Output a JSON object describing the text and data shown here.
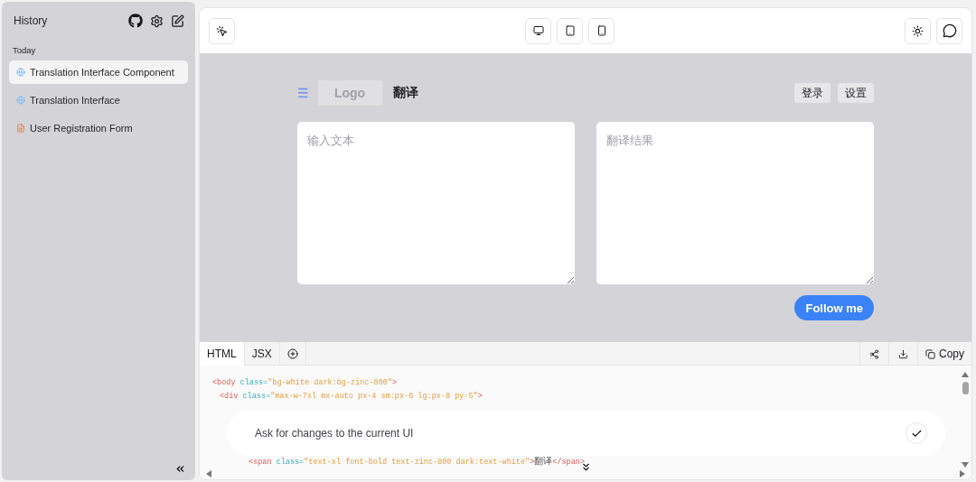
{
  "sidebar": {
    "title": "History",
    "section": "Today",
    "items": [
      {
        "label": "Translation Interface Component",
        "kind": "web",
        "selected": true
      },
      {
        "label": "Translation Interface",
        "kind": "web",
        "selected": false
      },
      {
        "label": "User Registration Form",
        "kind": "form",
        "selected": false
      }
    ]
  },
  "preview": {
    "menu_icon": "☰",
    "logo": "Logo",
    "title": "翻译",
    "buttons": [
      "登录",
      "设置"
    ],
    "fields": [
      {
        "placeholder": "输入文本"
      },
      {
        "placeholder": "翻译结果"
      }
    ],
    "follow": "Follow me"
  },
  "code": {
    "tabs": [
      {
        "label": "HTML",
        "selected": true
      },
      {
        "label": "JSX",
        "selected": false
      }
    ],
    "copy": "Copy",
    "lines": [
      {
        "parts": [
          {
            "kind": "tag",
            "text": "<body "
          },
          {
            "kind": "attr",
            "text": "class="
          },
          {
            "kind": "value",
            "text": "\"bg-white dark:bg-zinc-800\""
          },
          {
            "kind": "tag",
            "text": ">"
          }
        ],
        "children": [
          {
            "parts": [
              {
                "kind": "tag",
                "text": "<div "
              },
              {
                "kind": "attr",
                "text": "class="
              },
              {
                "kind": "value",
                "text": "\"max-w-7xl mx-auto px-4 sm:px-6 lg:px-8 py-5\""
              },
              {
                "kind": "tag",
                "text": ">"
              }
            ],
            "children": [
              {
                "parts": [
                  {
                    "kind": "tag",
                    "text": "<span "
                  },
                  {
                    "kind": "attr",
                    "text": "class="
                  },
                  {
                    "kind": "value",
                    "text": "\"text-xl font-bold text-zinc-800 dark:text-white\""
                  },
                  {
                    "kind": "tag",
                    "text": ">"
                  },
                  {
                    "kind": "plain",
                    "text": "翻译"
                  },
                  {
                    "kind": "tag",
                    "text": "</span>"
                  }
                ]
              }
            ]
          }
        ]
      }
    ]
  },
  "prompt": {
    "placeholder": "Ask for changes to the current UI"
  }
}
